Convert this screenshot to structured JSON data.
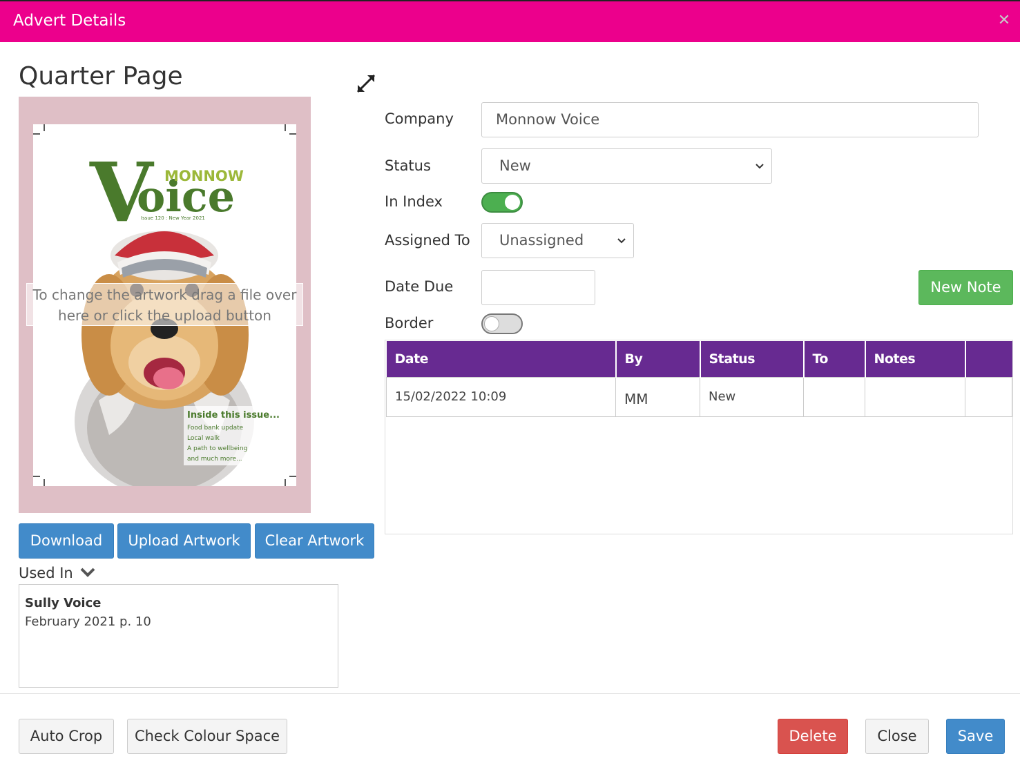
{
  "modal": {
    "title": "Advert Details",
    "close_glyph": "✕"
  },
  "advert": {
    "size_name": "Quarter Page"
  },
  "artwork": {
    "drop_hint": "To change the artwork drag a file over here or click the upload button",
    "cover": {
      "masthead_small": "MONNOW",
      "masthead_big_v": "V",
      "masthead_big_rest": "oice",
      "issue_line": "Issue 120 : New Year 2021",
      "inside_title": "Inside this issue...",
      "inside_items": [
        "Food bank update",
        "Local walk",
        "A path to wellbeing",
        "and much more..."
      ]
    }
  },
  "artwork_buttons": {
    "download": "Download",
    "upload": "Upload Artwork",
    "clear": "Clear Artwork"
  },
  "used_in": {
    "label": "Used In",
    "entries": [
      {
        "publication": "Sully Voice",
        "issue": "February 2021 p. 10"
      }
    ]
  },
  "form": {
    "company": {
      "label": "Company",
      "value": "Monnow Voice"
    },
    "status": {
      "label": "Status",
      "value": "New"
    },
    "in_index": {
      "label": "In Index",
      "checked": true
    },
    "assigned_to": {
      "label": "Assigned To",
      "value": "Unassigned"
    },
    "date_due": {
      "label": "Date Due",
      "value": ""
    },
    "border": {
      "label": "Border",
      "checked": false
    },
    "new_note": "New Note"
  },
  "notes_table": {
    "headers": [
      "Date",
      "By",
      "Status",
      "To",
      "Notes",
      ""
    ],
    "rows": [
      [
        "15/02/2022 10:09",
        "MM",
        "New",
        "",
        "",
        ""
      ]
    ]
  },
  "footer": {
    "auto_crop": "Auto Crop",
    "check_colour": "Check Colour Space",
    "delete": "Delete",
    "close": "Close",
    "save": "Save"
  },
  "colors": {
    "header": "#ec008c",
    "table_header": "#672a91",
    "primary": "#428bca",
    "success": "#5cb85c",
    "danger": "#d9534f"
  }
}
